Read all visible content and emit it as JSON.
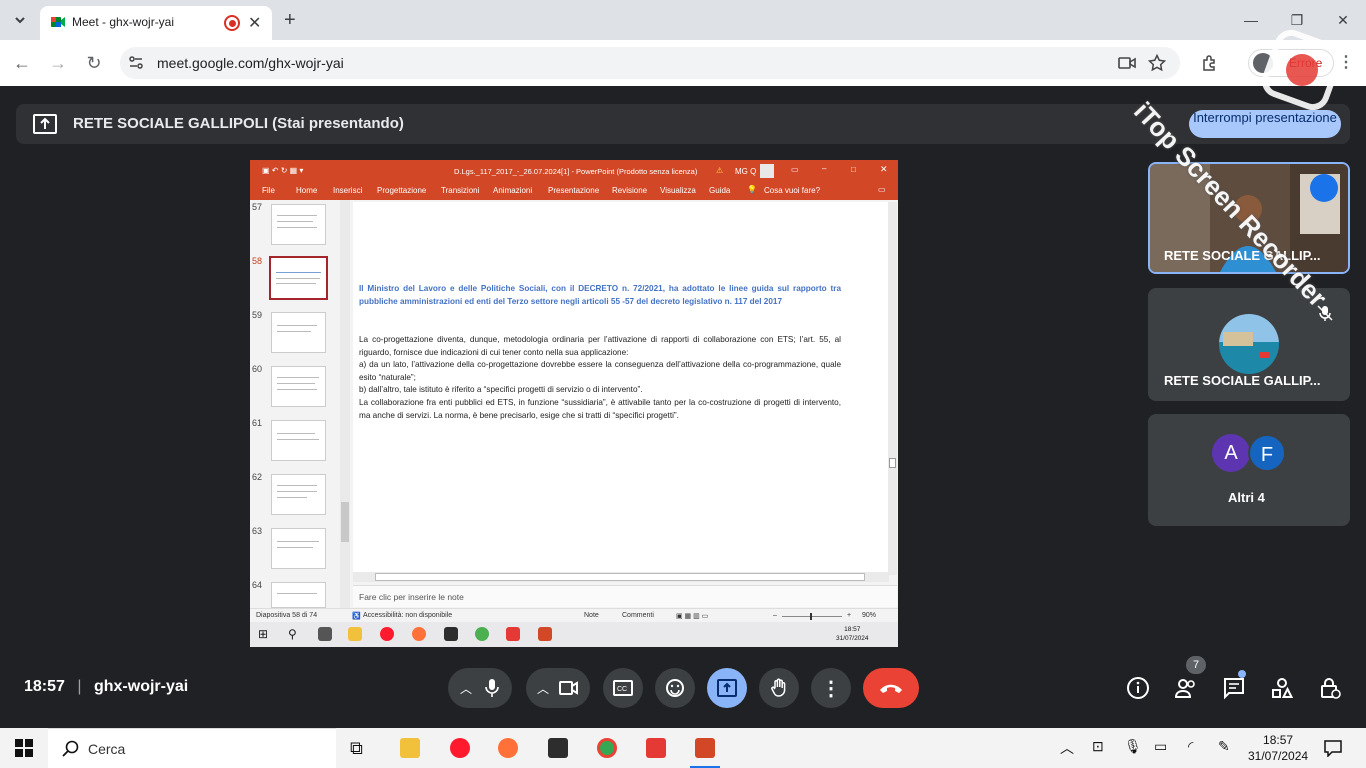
{
  "browser": {
    "tab_title": "Meet - ghx-wojr-yai",
    "url": "meet.google.com/ghx-wojr-yai",
    "profile_label": "Errore"
  },
  "meet": {
    "banner_text": "RETE SOCIALE GALLIPOLI (Stai presentando)",
    "stop_presenting_label": "Interrompi presentazione",
    "time": "18:57",
    "meeting_code": "ghx-wojr-yai",
    "participants_badge": "7",
    "tiles": [
      {
        "name": "RETE SOCIALE GALLIP..."
      },
      {
        "name": "RETE SOCIALE GALLIP..."
      },
      {
        "name": "Altri 4",
        "initials": [
          "A",
          "F"
        ]
      }
    ]
  },
  "ppt": {
    "window_title": "D.Lgs._117_2017_-_26.07.2024[1] - PowerPoint (Prodotto senza licenza)",
    "user_initials": "MG Q",
    "ribbon_tabs": [
      "File",
      "Home",
      "Inserisci",
      "Progettazione",
      "Transizioni",
      "Animazioni",
      "Presentazione",
      "Revisione",
      "Visualizza",
      "Guida"
    ],
    "tell_me": "Cosa vuoi fare?",
    "thumb_numbers": [
      "57",
      "58",
      "59",
      "60",
      "61",
      "62",
      "63",
      "64"
    ],
    "selected_slide": "58",
    "slide_heading": "Il Ministro del Lavoro e delle Politiche Sociali, con il DECRETO n. 72/2021, ha adottato le linee guida sul rapporto tra pubbliche amministrazioni ed enti del Terzo settore negli articoli 55 -57 del decreto legislativo n. 117 del 2017",
    "slide_body": [
      "La co-progettazione diventa, dunque, metodologia ordinaria per l’attivazione di rapporti di collaborazione con ETS; l’art. 55, al riguardo, fornisce due indicazioni di cui tener conto nella sua applicazione:",
      "a) da un lato, l’attivazione della co-progettazione dovrebbe essere la conseguenza dell’attivazione della co-programmazione, quale esito “naturale”;",
      "b) dall’altro, tale istituto è riferito a “specifici progetti di servizio o di intervento”.",
      "La collaborazione fra enti pubblici ed ETS, in funzione “sussidiaria”, è attivabile tanto per la co-costruzione di progetti di intervento, ma anche di servizi. La norma, è bene precisarlo, esige che si tratti di “specifici progetti”."
    ],
    "notes_placeholder": "Fare clic per inserire le note",
    "status_slide": "Diapositiva 58 di 74",
    "status_accessibility": "Accessibilità: non disponibile",
    "status_notes": "Note",
    "status_comments": "Commenti",
    "zoom": "90%",
    "inner_clock_time": "18:57",
    "inner_clock_date": "31/07/2024"
  },
  "taskbar": {
    "search_placeholder": "Cerca",
    "time": "18:57",
    "date": "31/07/2024"
  },
  "watermark": {
    "text": "iTop Screen Recorder"
  },
  "colors": {
    "meet_bg": "#202124",
    "ppt_accent": "#d24726",
    "end_call": "#ea4335",
    "present_active": "#8ab4f8"
  }
}
